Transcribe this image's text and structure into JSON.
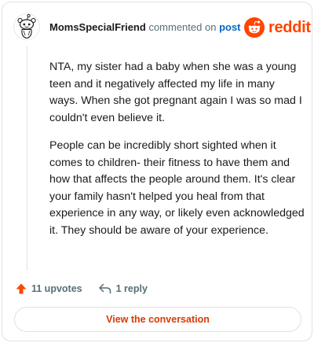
{
  "header": {
    "username": "MomsSpecialFriend",
    "action_text": "commented on",
    "post_link": "post",
    "brand": "reddit"
  },
  "comment": {
    "paragraphs": [
      "NTA, my sister had a baby when she was a young teen and it negatively affected my life in many ways. When she got pregnant again I was so mad I couldn't even believe it.",
      "People can be incredibly short sighted when it comes to children- their fitness to have them and how that affects the people around them. It's clear your family hasn't helped you heal from that experience in any way, or likely even acknowledged it. They should be aware of your experience."
    ]
  },
  "actions": {
    "upvotes_label": "11 upvotes",
    "reply_label": "1 reply"
  },
  "cta": {
    "label": "View the conversation"
  },
  "colors": {
    "brand": "#ff4500",
    "upvote": "#ff4500",
    "link": "#0a66c2",
    "cta_text": "#d93a00",
    "muted": "#576f76"
  }
}
